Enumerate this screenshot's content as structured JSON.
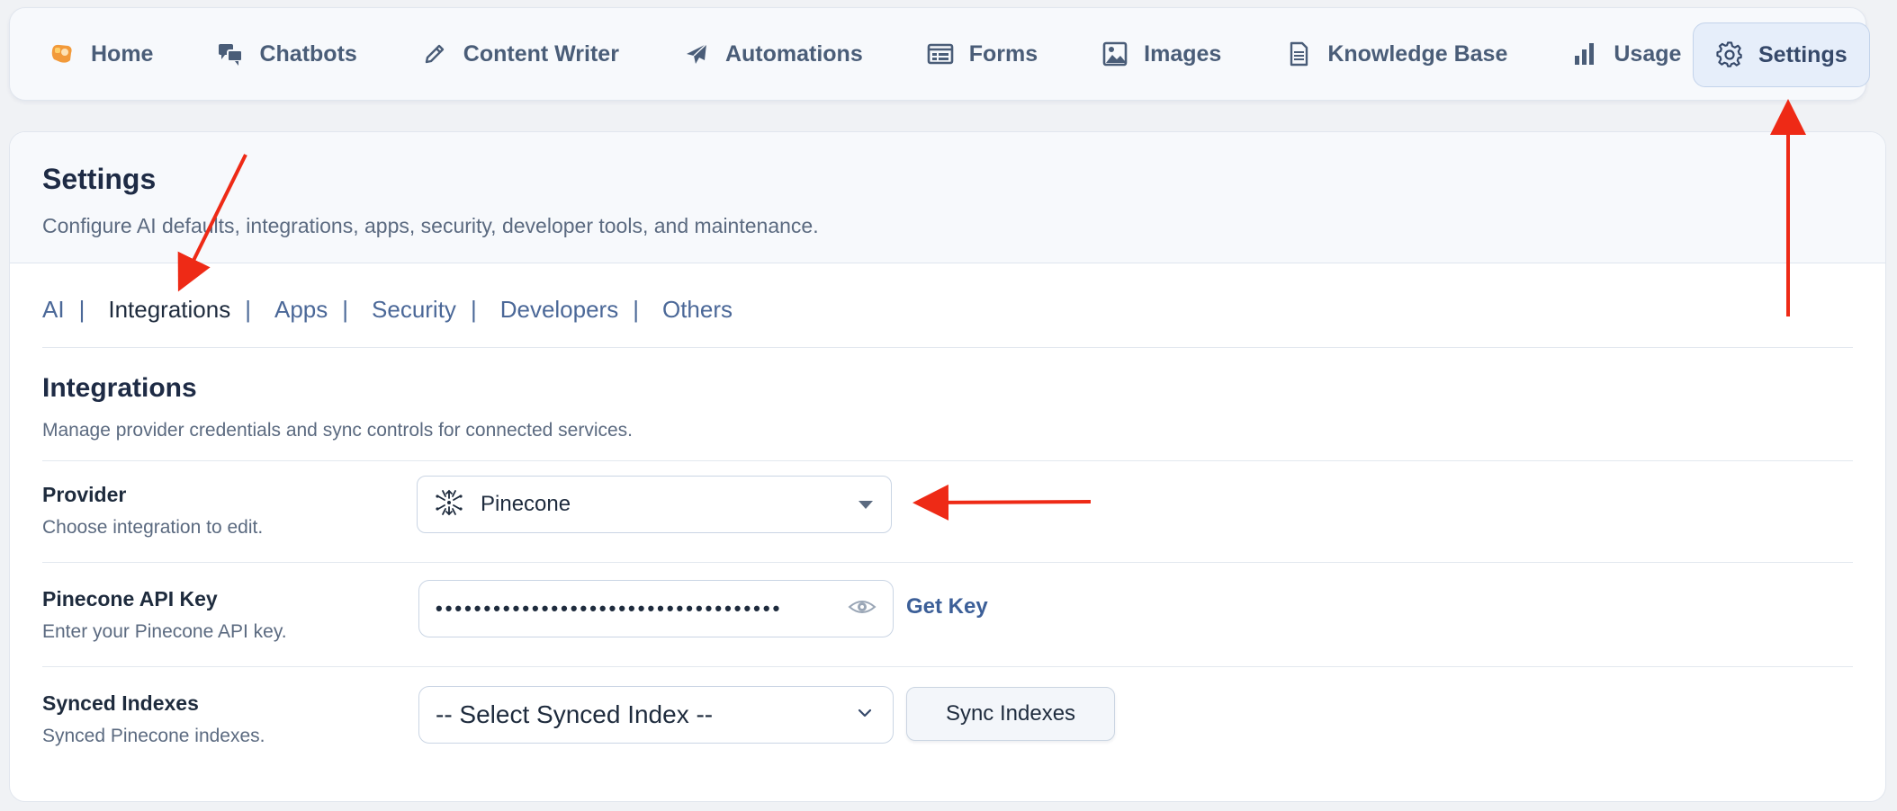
{
  "nav": {
    "items": [
      {
        "label": "Home",
        "icon": "home-logo-icon"
      },
      {
        "label": "Chatbots",
        "icon": "chat-bubbles-icon"
      },
      {
        "label": "Content Writer",
        "icon": "pencil-icon"
      },
      {
        "label": "Automations",
        "icon": "airplane-icon"
      },
      {
        "label": "Forms",
        "icon": "form-icon"
      },
      {
        "label": "Images",
        "icon": "image-icon"
      },
      {
        "label": "Knowledge Base",
        "icon": "document-icon"
      },
      {
        "label": "Usage",
        "icon": "bar-chart-icon"
      },
      {
        "label": "Settings",
        "icon": "gear-icon",
        "active": true
      }
    ]
  },
  "page": {
    "title": "Settings",
    "subtitle": "Configure AI defaults, integrations, apps, security, developer tools, and maintenance."
  },
  "tabs": [
    {
      "label": "AI"
    },
    {
      "label": "Integrations",
      "current": true
    },
    {
      "label": "Apps"
    },
    {
      "label": "Security"
    },
    {
      "label": "Developers"
    },
    {
      "label": "Others"
    }
  ],
  "tab_separator": "|",
  "section": {
    "title": "Integrations",
    "subtitle": "Manage provider credentials and sync controls for connected services."
  },
  "fields": {
    "provider": {
      "label": "Provider",
      "help": "Choose integration to edit.",
      "value": "Pinecone",
      "logo_icon": "pinecone-logo-icon"
    },
    "api_key": {
      "label": "Pinecone API Key",
      "help": "Enter your Pinecone API key.",
      "masked_value": "••••••••••••••••••••••••••••••••••••",
      "toggle_icon": "eye-icon",
      "link_label": "Get Key"
    },
    "synced_indexes": {
      "label": "Synced Indexes",
      "help": "Synced Pinecone indexes.",
      "value": "-- Select Synced Index --",
      "button_label": "Sync Indexes"
    }
  },
  "colors": {
    "accent": "#4b6898",
    "annotation_arrow": "#ee2a16",
    "active_nav_bg": "#e6eefa"
  }
}
